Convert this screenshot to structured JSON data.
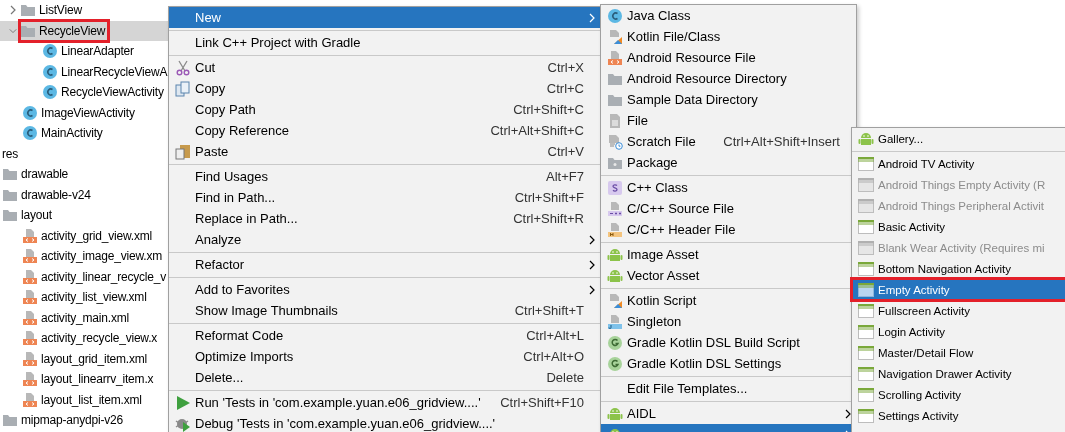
{
  "tree": [
    {
      "label": "ListView",
      "kind": "folder",
      "expanded": false,
      "selected": false,
      "highlighted": false
    },
    {
      "label": "RecycleView",
      "kind": "folder",
      "expanded": true,
      "selected": true,
      "highlighted": true,
      "children": [
        {
          "label": "LinearAdapter",
          "kind": "class",
          "selected": false
        },
        {
          "label": "LinearRecycleViewA",
          "kind": "class",
          "selected": false
        },
        {
          "label": "RecycleViewActivity",
          "kind": "class",
          "selected": false
        }
      ]
    },
    {
      "label": "ImageViewActivity",
      "kind": "class",
      "selected": false
    },
    {
      "label": "MainActivity",
      "kind": "class",
      "selected": false
    },
    {
      "label": "res",
      "kind": "group",
      "selected": false,
      "children": [
        {
          "label": "drawable",
          "kind": "folder",
          "selected": false
        },
        {
          "label": "drawable-v24",
          "kind": "folder",
          "selected": false
        },
        {
          "label": "layout",
          "kind": "folder",
          "selected": false,
          "children": [
            {
              "label": "activity_grid_view.xml",
              "kind": "xml",
              "selected": false
            },
            {
              "label": "activity_image_view.xm",
              "kind": "xml",
              "selected": false
            },
            {
              "label": "activity_linear_recycle_v",
              "kind": "xml",
              "selected": false
            },
            {
              "label": "activity_list_view.xml",
              "kind": "xml",
              "selected": false
            },
            {
              "label": "activity_main.xml",
              "kind": "xml",
              "selected": false
            },
            {
              "label": "activity_recycle_view.x",
              "kind": "xml",
              "selected": false
            },
            {
              "label": "layout_grid_item.xml",
              "kind": "xml",
              "selected": false
            },
            {
              "label": "layout_linearrv_item.x",
              "kind": "xml",
              "selected": false
            },
            {
              "label": "layout_list_item.xml",
              "kind": "xml",
              "selected": false
            }
          ]
        },
        {
          "label": "mipmap-anydpi-v26",
          "kind": "folder",
          "selected": false
        }
      ]
    }
  ],
  "context_menu": [
    {
      "kind": "plain",
      "label": "New",
      "submenu": true,
      "selected": true
    },
    {
      "kind": "separator"
    },
    {
      "kind": "plain",
      "label": "Link C++ Project with Gradle",
      "selected": false
    },
    {
      "kind": "separator"
    },
    {
      "kind": "scissors",
      "label": "Cut",
      "shortcut": "Ctrl+X",
      "selected": false
    },
    {
      "kind": "copy",
      "label": "Copy",
      "shortcut": "Ctrl+C",
      "selected": false
    },
    {
      "kind": "plain",
      "label": "Copy Path",
      "shortcut": "Ctrl+Shift+C",
      "selected": false
    },
    {
      "kind": "plain",
      "label": "Copy Reference",
      "shortcut": "Ctrl+Alt+Shift+C",
      "selected": false
    },
    {
      "kind": "paste",
      "label": "Paste",
      "shortcut": "Ctrl+V",
      "selected": false
    },
    {
      "kind": "separator"
    },
    {
      "kind": "plain",
      "label": "Find Usages",
      "shortcut": "Alt+F7",
      "selected": false
    },
    {
      "kind": "plain",
      "label": "Find in Path...",
      "shortcut": "Ctrl+Shift+F",
      "selected": false
    },
    {
      "kind": "plain",
      "label": "Replace in Path...",
      "shortcut": "Ctrl+Shift+R",
      "selected": false
    },
    {
      "kind": "plain",
      "label": "Analyze",
      "submenu": true,
      "selected": false
    },
    {
      "kind": "separator"
    },
    {
      "kind": "plain",
      "label": "Refactor",
      "submenu": true,
      "selected": false
    },
    {
      "kind": "separator"
    },
    {
      "kind": "plain",
      "label": "Add to Favorites",
      "submenu": true,
      "selected": false
    },
    {
      "kind": "plain",
      "label": "Show Image Thumbnails",
      "shortcut": "Ctrl+Shift+T",
      "selected": false
    },
    {
      "kind": "separator"
    },
    {
      "kind": "plain",
      "label": "Reformat Code",
      "shortcut": "Ctrl+Alt+L",
      "selected": false
    },
    {
      "kind": "plain",
      "label": "Optimize Imports",
      "shortcut": "Ctrl+Alt+O",
      "selected": false
    },
    {
      "kind": "plain",
      "label": "Delete...",
      "shortcut": "Delete",
      "selected": false
    },
    {
      "kind": "separator"
    },
    {
      "kind": "run",
      "label": "Run 'Tests in 'com.example.yuan.e06_gridview....'",
      "shortcut": "Ctrl+Shift+F10",
      "selected": false
    },
    {
      "kind": "debug",
      "label": "Debug 'Tests in 'com.example.yuan.e06_gridview....'",
      "selected": false
    }
  ],
  "new_submenu": [
    {
      "kind": "class",
      "label": "Java Class",
      "selected": false
    },
    {
      "kind": "kotlin",
      "label": "Kotlin File/Class",
      "selected": false
    },
    {
      "kind": "xml",
      "label": "Android Resource File",
      "selected": false
    },
    {
      "kind": "folder",
      "label": "Android Resource Directory",
      "selected": false
    },
    {
      "kind": "folder",
      "label": "Sample Data Directory",
      "selected": false
    },
    {
      "kind": "file",
      "label": "File",
      "selected": false
    },
    {
      "kind": "scratch",
      "label": "Scratch File",
      "shortcut": "Ctrl+Alt+Shift+Insert",
      "selected": false
    },
    {
      "kind": "package",
      "label": "Package",
      "selected": false
    },
    {
      "kind": "separator"
    },
    {
      "kind": "cppclass",
      "label": "C++ Class",
      "selected": false
    },
    {
      "kind": "cppsource",
      "label": "C/C++ Source File",
      "selected": false
    },
    {
      "kind": "cppheader",
      "label": "C/C++ Header File",
      "selected": false
    },
    {
      "kind": "separator"
    },
    {
      "kind": "android",
      "label": "Image Asset",
      "selected": false
    },
    {
      "kind": "android",
      "label": "Vector Asset",
      "selected": false
    },
    {
      "kind": "separator"
    },
    {
      "kind": "kotlin",
      "label": "Kotlin Script",
      "selected": false
    },
    {
      "kind": "singleton",
      "label": "Singleton",
      "selected": false
    },
    {
      "kind": "gradle",
      "label": "Gradle Kotlin DSL Build Script",
      "selected": false
    },
    {
      "kind": "gradle",
      "label": "Gradle Kotlin DSL Settings",
      "selected": false
    },
    {
      "kind": "separator"
    },
    {
      "kind": "plain",
      "label": "Edit File Templates...",
      "selected": false
    },
    {
      "kind": "separator"
    },
    {
      "kind": "android",
      "label": "AIDL",
      "submenu": true,
      "selected": false
    },
    {
      "kind": "android",
      "submenu": true,
      "selected": true
    }
  ],
  "activity_submenu": [
    {
      "kind": "android",
      "label": "Gallery...",
      "disabled": false,
      "selected": false,
      "highlighted": false
    },
    {
      "kind": "separator"
    },
    {
      "kind": "template",
      "label": "Android TV Activity",
      "disabled": false,
      "selected": false,
      "highlighted": false
    },
    {
      "kind": "template",
      "label": "Android Things Empty Activity (R",
      "disabled": true,
      "selected": false,
      "highlighted": false
    },
    {
      "kind": "template",
      "label": "Android Things Peripheral Activit",
      "disabled": true,
      "selected": false,
      "highlighted": false
    },
    {
      "kind": "template",
      "label": "Basic Activity",
      "disabled": false,
      "selected": false,
      "highlighted": false
    },
    {
      "kind": "template",
      "label": "Blank Wear Activity (Requires mi",
      "disabled": true,
      "selected": false,
      "highlighted": false
    },
    {
      "kind": "template",
      "label": "Bottom Navigation Activity",
      "disabled": false,
      "selected": false,
      "highlighted": false
    },
    {
      "kind": "template",
      "label": "Empty Activity",
      "disabled": false,
      "selected": true,
      "highlighted": true
    },
    {
      "kind": "template",
      "label": "Fullscreen Activity",
      "disabled": false,
      "selected": false,
      "highlighted": false
    },
    {
      "kind": "template",
      "label": "Login Activity",
      "disabled": false,
      "selected": false,
      "highlighted": false
    },
    {
      "kind": "template",
      "label": "Master/Detail Flow",
      "disabled": false,
      "selected": false,
      "highlighted": false
    },
    {
      "kind": "template",
      "label": "Navigation Drawer Activity",
      "disabled": false,
      "selected": false,
      "highlighted": false
    },
    {
      "kind": "template",
      "label": "Scrolling Activity",
      "disabled": false,
      "selected": false,
      "highlighted": false
    },
    {
      "kind": "template",
      "label": "Settings Activity",
      "disabled": false,
      "selected": false,
      "highlighted": false
    }
  ]
}
